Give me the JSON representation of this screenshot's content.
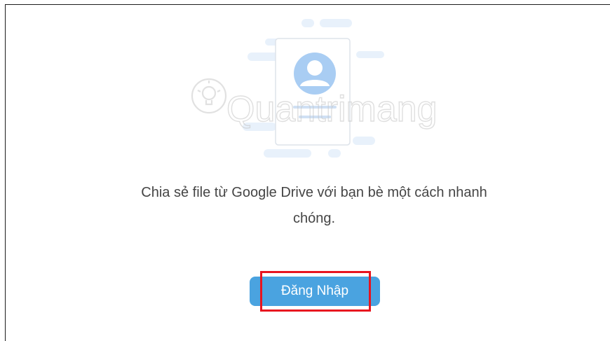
{
  "watermark": {
    "text": "Quantrimang",
    "icon": "lightbulb-icon"
  },
  "illustration": {
    "icon": "user-profile-card-icon"
  },
  "message": {
    "line1": "Chia sẻ file từ Google Drive với bạn bè một cách nhanh",
    "line2": "chóng."
  },
  "login_button": {
    "label": "Đăng Nhập"
  },
  "colors": {
    "button": "#4aa3e0",
    "highlight": "#e8141f",
    "text": "#454545"
  }
}
